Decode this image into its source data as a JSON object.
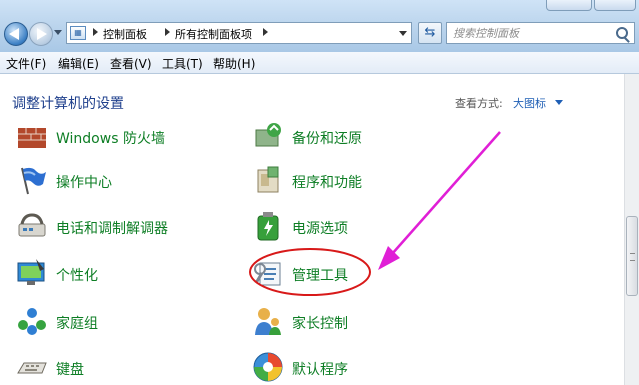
{
  "address_bar": {
    "crumbs": [
      "控制面板",
      "所有控制面板项"
    ]
  },
  "search": {
    "placeholder": "搜索控制面板"
  },
  "menu": [
    "文件(F)",
    "编辑(E)",
    "查看(V)",
    "工具(T)",
    "帮助(H)"
  ],
  "content": {
    "title": "调整计算机的设置",
    "view_label": "查看方式:",
    "view_value": "大图标"
  },
  "items": [
    {
      "label": "Windows 防火墙",
      "icon": "firewall-icon"
    },
    {
      "label": "备份和还原",
      "icon": "backup-icon"
    },
    {
      "label": "操作中心",
      "icon": "action-center-flag-icon"
    },
    {
      "label": "程序和功能",
      "icon": "programs-icon"
    },
    {
      "label": "电话和调制解调器",
      "icon": "phone-modem-icon"
    },
    {
      "label": "电源选项",
      "icon": "power-options-icon"
    },
    {
      "label": "个性化",
      "icon": "personalization-icon"
    },
    {
      "label": "管理工具",
      "icon": "admin-tools-icon"
    },
    {
      "label": "家庭组",
      "icon": "homegroup-icon"
    },
    {
      "label": "家长控制",
      "icon": "parental-controls-icon"
    },
    {
      "label": "键盘",
      "icon": "keyboard-icon"
    },
    {
      "label": "默认程序",
      "icon": "default-programs-icon"
    }
  ],
  "colors": {
    "item_label": "#0e7e25",
    "title": "#1e3f8c",
    "annotation": "#e01fd6",
    "highlight_ring": "#d81919"
  }
}
